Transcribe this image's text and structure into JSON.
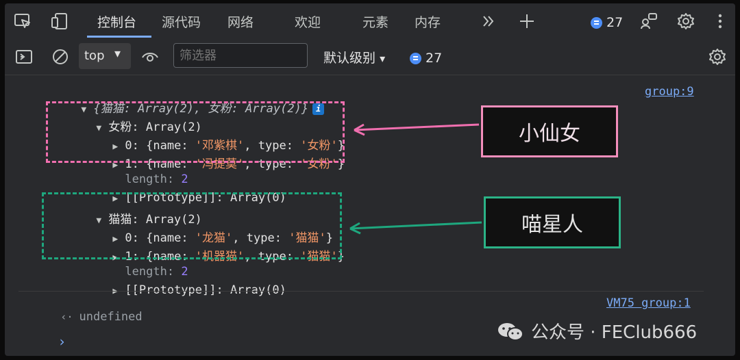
{
  "tabs": [
    "控制台",
    "源代码",
    "网络",
    "欢迎",
    "元素",
    "内存"
  ],
  "top_badge_count": "27",
  "toolbar": {
    "context": "top",
    "filter_placeholder": "筛选器",
    "level": "默认级别",
    "badge_count": "27"
  },
  "console": {
    "root": "{猫猫: Array(2), 女粉: Array(2)}",
    "root_link": "group:9",
    "info_badge": "i",
    "group1": {
      "key": "女粉",
      "value": "Array(2)",
      "items": [
        {
          "idx": "0",
          "name": "邓紫棋",
          "type": "女粉"
        },
        {
          "idx": "1",
          "name": "冯提莫",
          "type": "女粉"
        }
      ],
      "length_label": "length",
      "length_value": "2",
      "proto": "[[Prototype]]: Array(0)"
    },
    "group2": {
      "key": "猫猫",
      "value": "Array(2)",
      "items": [
        {
          "idx": "0",
          "name": "龙猫",
          "type": "猫猫"
        },
        {
          "idx": "1",
          "name": "机器猫",
          "type": "猫猫"
        }
      ],
      "length_label": "length",
      "length_value": "2",
      "proto": "[[Prototype]]: Array(0)"
    },
    "result": "undefined",
    "result_link": "VM75 group:1"
  },
  "annotations": {
    "pink_label": "小仙女",
    "green_label": "喵星人",
    "pink_color": "#f06faf",
    "green_color": "#1ea77e"
  },
  "watermark": "公众号 · FEClub666"
}
